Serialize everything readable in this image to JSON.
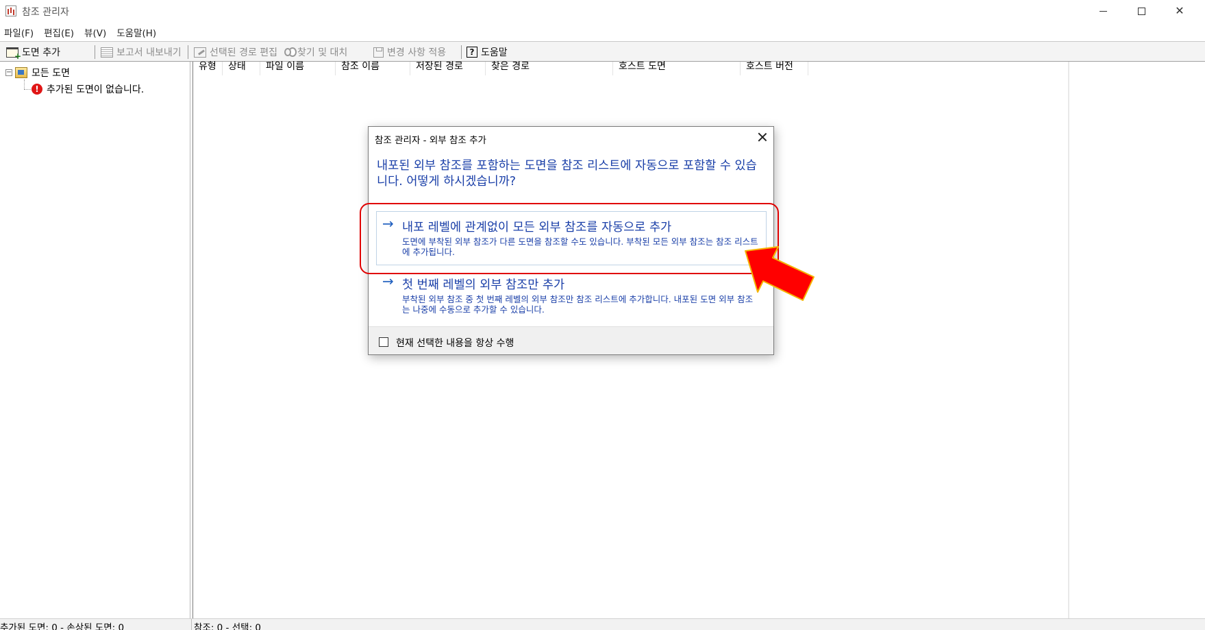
{
  "window": {
    "title": "참조 관리자"
  },
  "menu": [
    "파일(F)",
    "편집(E)",
    "뷰(V)",
    "도움말(H)"
  ],
  "toolbar": {
    "add_drawing": "도면 추가",
    "export_report": "보고서 내보내기",
    "edit_selected_path": "선택된 경로 편집",
    "find_replace": "찾기 및 대치",
    "apply_changes": "변경 사항 적용",
    "help": "도움말"
  },
  "tree": {
    "root_label": "모든 도면",
    "empty_message": "추가된 도면이 없습니다."
  },
  "columns": [
    "유형",
    "상태",
    "파일 이름",
    "참조 이름",
    "저장된 경로",
    "찾은 경로",
    "호스트 도면",
    "호스트 버전"
  ],
  "status": {
    "left": "추가된 도면: 0  -  손상된 도면: 0",
    "right": "참조: 0  -  선택: 0"
  },
  "dialog": {
    "title": "참조 관리자 - 외부 참조 추가",
    "instruction": "내포된 외부 참조를 포함하는 도면을 참조 리스트에 자동으로 포함할 수 있습니다. 어떻게 하시겠습니까?",
    "option1": {
      "title": "내포 레벨에 관계없이 모든 외부 참조를 자동으로 추가",
      "note": "도면에 부착된 외부 참조가 다른 도면을 참조할 수도 있습니다. 부착된 모든 외부 참조는 참조 리스트에 추가됩니다."
    },
    "option2": {
      "title": "첫 번째 레벨의 외부 참조만 추가",
      "note": "부착된 외부 참조 중 첫 번째 레벨의 외부 참조만 참조 리스트에 추가합니다. 내포된 도면 외부 참조는 나중에 수동으로 추가할 수 있습니다."
    },
    "always_checkbox": "현재 선택한 내용을 항상 수행",
    "always_checked": false
  },
  "colors": {
    "dialog_text": "#1a3fa8",
    "highlight": "#e00000",
    "arrow_fill": "#ff0000",
    "arrow_outline": "#f5b400"
  }
}
